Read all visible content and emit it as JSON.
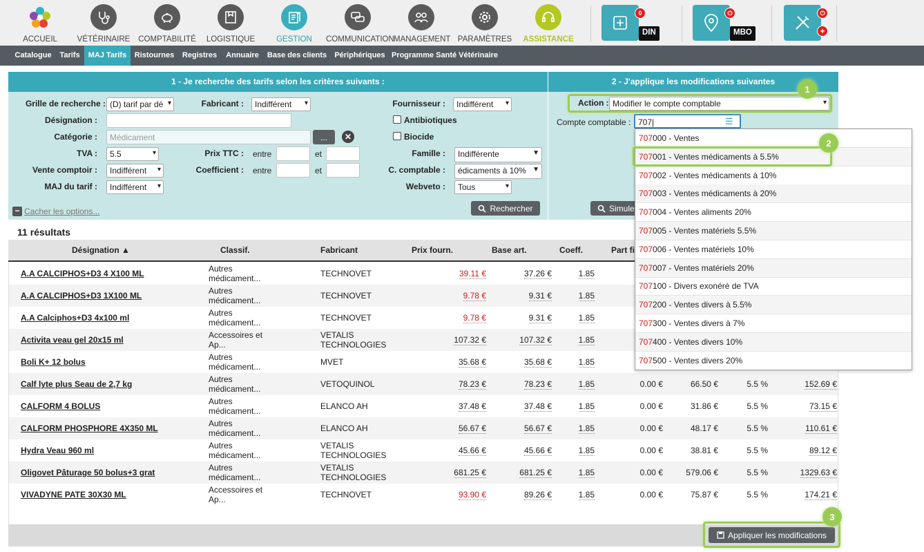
{
  "nav": [
    {
      "label": "ACCUEIL",
      "icon": "flower-logo-icon"
    },
    {
      "label": "VÉTÉRINAIRE",
      "icon": "stethoscope-icon"
    },
    {
      "label": "COMPTABILITÉ",
      "icon": "piggy-bank-icon"
    },
    {
      "label": "LOGISTIQUE",
      "icon": "box-icon"
    },
    {
      "label": "GESTION",
      "icon": "clipboard-icon"
    },
    {
      "label": "COMMUNICATION",
      "icon": "chat-bubbles-icon"
    },
    {
      "label": "MANAGEMENT",
      "icon": "team-icon"
    },
    {
      "label": "PARAMÈTRES",
      "icon": "gear-icon"
    },
    {
      "label": "ASSISTANCE",
      "icon": "headset-icon"
    }
  ],
  "tiles": {
    "din_label": "DIN",
    "din_count": "0",
    "mbo_label": "MBO"
  },
  "subnav": [
    "Catalogue",
    "Tarifs",
    "MAJ Tarifs",
    "Ristournes",
    "Registres",
    "Annuaire",
    "Base des clients",
    "Périphériques",
    "Programme Santé Vétérinaire"
  ],
  "search": {
    "header": "1 - Je recherche des tarifs selon les critères suivants :",
    "grille_label": "Grille de recherche :",
    "grille_value": "(D) tarif par dé",
    "fabricant_label": "Fabricant :",
    "fabricant_value": "Indifférent",
    "fournisseur_label": "Fournisseur :",
    "fournisseur_value": "Indifférent",
    "designation_label": "Désignation :",
    "categorie_label": "Catégorie :",
    "categorie_placeholder": "Médicament",
    "browse_label": "...",
    "antibiotiques_label": "Antibiotiques",
    "biocide_label": "Biocide",
    "tva_label": "TVA :",
    "tva_value": "5.5",
    "prix_ttc_label": "Prix TTC :",
    "entre": "entre",
    "et": "et",
    "famille_label": "Famille :",
    "famille_value": "Indifférente",
    "vente_label": "Vente comptoir :",
    "vente_value": "Indifférent",
    "coef_label": "Coefficient :",
    "ccompta_label": "C. comptable :",
    "ccompta_value": "édicaments à 10%",
    "maj_label": "MAJ du tarif :",
    "maj_value": "Indifférent",
    "webveto_label": "Webveto :",
    "webveto_value": "Tous",
    "hide_options": "Cacher les options...",
    "search_button": "Rechercher"
  },
  "apply": {
    "header": "2 - J'applique les modifications suivantes",
    "action_label": "Action :",
    "action_value": "Modifier le compte comptable",
    "compte_label": "Compte comptable :",
    "compte_value": "707",
    "simulate_button": "Simule",
    "apply_button": "Appliquer les modifications"
  },
  "steps": [
    "1",
    "2",
    "3"
  ],
  "results": {
    "count": "11 résultats",
    "columns": [
      "Désignation ▲",
      "Classif.",
      "Fabricant",
      "Prix fourn.",
      "Base art.",
      "Coeff.",
      "Part fi"
    ],
    "rows": [
      {
        "name": "A.A CALCIPHOS+D3 4 X100 ML",
        "classif": [
          "Autres",
          "médicament..."
        ],
        "fab": [
          "TECHNOVET"
        ],
        "prix": "39.11 €",
        "prix_red": true,
        "base": "37.26 €",
        "coef": "1.85",
        "p1": "",
        "p2": "",
        "p3": "",
        "p4": ""
      },
      {
        "name": "A.A CALCIPHOS+D3 1X100 ML",
        "classif": [
          "Autres",
          "médicament..."
        ],
        "fab": [
          "TECHNOVET"
        ],
        "prix": "9.78 €",
        "prix_red": true,
        "base": "9.31 €",
        "coef": "1.85",
        "p1": "",
        "p2": "",
        "p3": "",
        "p4": ""
      },
      {
        "name": "A.A Calciphos+D3 4x100 ml",
        "classif": [
          "Autres",
          "médicament..."
        ],
        "fab": [
          "TECHNOVET"
        ],
        "prix": "9.78 €",
        "prix_red": true,
        "base": "9.31 €",
        "coef": "1.85",
        "p1": "",
        "p2": "",
        "p3": "",
        "p4": ""
      },
      {
        "name": "Activita veau gel 20x15 ml",
        "classif": [
          "Accessoires et",
          "Ap..."
        ],
        "fab": [
          "VETALIS",
          "TECHNOLOGIES"
        ],
        "prix": "107.32 €",
        "prix_red": false,
        "base": "107.32 €",
        "coef": "1.85",
        "p1": "",
        "p2": "",
        "p3": "",
        "p4": ""
      },
      {
        "name": "Boli K+ 12 bolus",
        "classif": [
          "Autres",
          "médicament..."
        ],
        "fab": [
          "MVET"
        ],
        "prix": "35.68 €",
        "prix_red": false,
        "base": "35.68 €",
        "coef": "1.85",
        "p1": "",
        "p2": "",
        "p3": "",
        "p4": ""
      },
      {
        "name": "Calf lyte plus Seau de 2,7 kg",
        "classif": [
          "Autres",
          "médicament..."
        ],
        "fab": [
          "VETOQUINOL"
        ],
        "prix": "78.23 €",
        "prix_red": false,
        "base": "78.23 €",
        "coef": "1.85",
        "p1": "0.00 €",
        "p2": "66.50 €",
        "p3": "5.5 %",
        "p4": "152.69 €"
      },
      {
        "name": "CALFORM 4 BOLUS",
        "classif": [
          "Autres",
          "médicament..."
        ],
        "fab": [
          "ELANCO AH"
        ],
        "prix": "37.48 €",
        "prix_red": false,
        "base": "37.48 €",
        "coef": "1.85",
        "p1": "0.00 €",
        "p2": "31.86 €",
        "p3": "5.5 %",
        "p4": "73.15 €"
      },
      {
        "name": "CALFORM PHOSPHORE 4X350 ML",
        "classif": [
          "Autres",
          "médicament..."
        ],
        "fab": [
          "ELANCO AH"
        ],
        "prix": "56.67 €",
        "prix_red": false,
        "base": "56.67 €",
        "coef": "1.85",
        "p1": "0.00 €",
        "p2": "48.17 €",
        "p3": "5.5 %",
        "p4": "110.61 €"
      },
      {
        "name": "Hydra Veau 960 ml",
        "classif": [
          "Autres",
          "médicament..."
        ],
        "fab": [
          "VETALIS",
          "TECHNOLOGIES"
        ],
        "prix": "45.66 €",
        "prix_red": false,
        "base": "45.66 €",
        "coef": "1.85",
        "p1": "0.00 €",
        "p2": "38.81 €",
        "p3": "5.5 %",
        "p4": "89.12 €"
      },
      {
        "name": "Oligovet Pâturage 50 bolus+3 grat",
        "classif": [
          "Autres",
          "médicament..."
        ],
        "fab": [
          "VETALIS",
          "TECHNOLOGIES"
        ],
        "prix": "681.25 €",
        "prix_red": false,
        "base": "681.25 €",
        "coef": "1.85",
        "p1": "0.00 €",
        "p2": "579.06 €",
        "p3": "5.5 %",
        "p4": "1329.63 €"
      },
      {
        "name": "VIVADYNE PATE 30X30 ML",
        "classif": [
          "Accessoires et",
          "Ap..."
        ],
        "fab": [
          "TECHNOVET"
        ],
        "prix": "93.90 €",
        "prix_red": true,
        "base": "89.26 €",
        "coef": "1.85",
        "p1": "0.00 €",
        "p2": "75.87 €",
        "p3": "5.5 %",
        "p4": "174.21 €"
      }
    ]
  },
  "dropdown": [
    {
      "code": "707",
      "rest": "000 - Ventes"
    },
    {
      "code": "707",
      "rest": "001 - Ventes médicaments à 5.5%"
    },
    {
      "code": "707",
      "rest": "002 - Ventes médicaments à 10%"
    },
    {
      "code": "707",
      "rest": "003 - Ventes médicaments à 20%"
    },
    {
      "code": "707",
      "rest": "004 - Ventes aliments 20%"
    },
    {
      "code": "707",
      "rest": "005 - Ventes matériels 5.5%"
    },
    {
      "code": "707",
      "rest": "006 - Ventes matériels 10%"
    },
    {
      "code": "707",
      "rest": "007 - Ventes matériels 20%"
    },
    {
      "code": "707",
      "rest": "100 - Divers exonéré de TVA"
    },
    {
      "code": "707",
      "rest": "200 - Ventes divers à 5.5%"
    },
    {
      "code": "707",
      "rest": "300 - Ventes divers à 7%"
    },
    {
      "code": "707",
      "rest": "400 - Ventes divers 10%"
    },
    {
      "code": "707",
      "rest": "500 - Ventes divers 20%"
    }
  ],
  "colors": {
    "accent": "#38a9b9",
    "panel": "#c9e6e6",
    "highlight": "#99cc55",
    "price_red": "#cc1b1b"
  }
}
